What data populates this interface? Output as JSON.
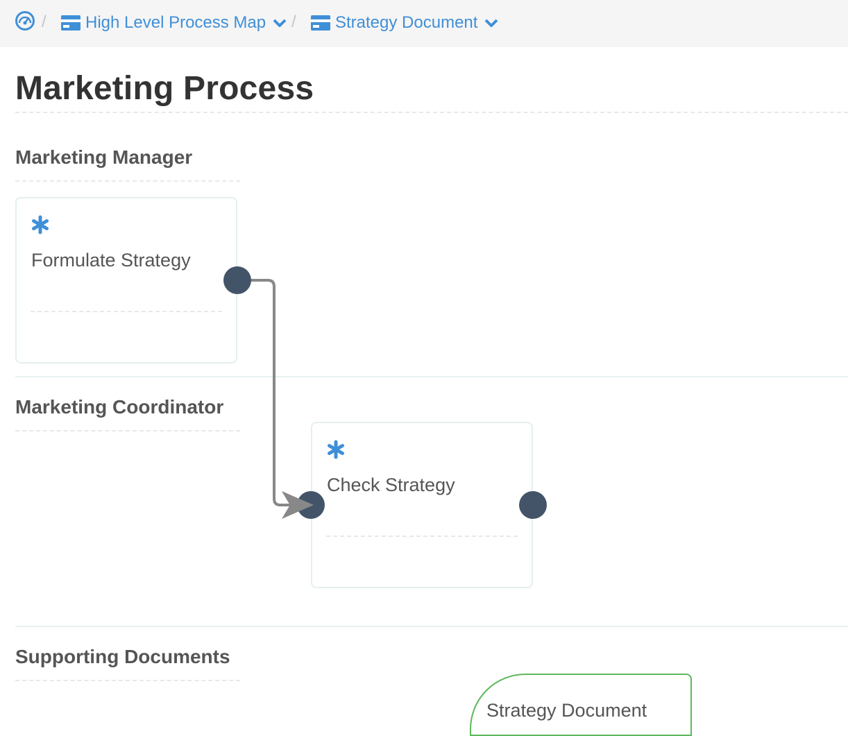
{
  "breadcrumb": {
    "home_icon": "dashboard-gauge-icon",
    "separator": "/",
    "items": [
      {
        "label": "High Level Process Map",
        "icon": "card-icon"
      },
      {
        "label": "Strategy Document",
        "icon": "card-icon"
      }
    ]
  },
  "page": {
    "title": "Marketing Process"
  },
  "lanes": [
    {
      "title": "Marketing Manager",
      "tasks": [
        {
          "label": "Formulate Strategy",
          "icon": "asterisk-icon"
        }
      ]
    },
    {
      "title": "Marketing Coordinator",
      "tasks": [
        {
          "label": "Check Strategy",
          "icon": "asterisk-icon"
        }
      ]
    },
    {
      "title": "Supporting Documents",
      "documents": [
        {
          "label": "Strategy Document"
        }
      ]
    }
  ],
  "colors": {
    "link": "#3f8fd8",
    "port": "#435469",
    "connector": "#888888",
    "document_border": "#5cb85c"
  }
}
